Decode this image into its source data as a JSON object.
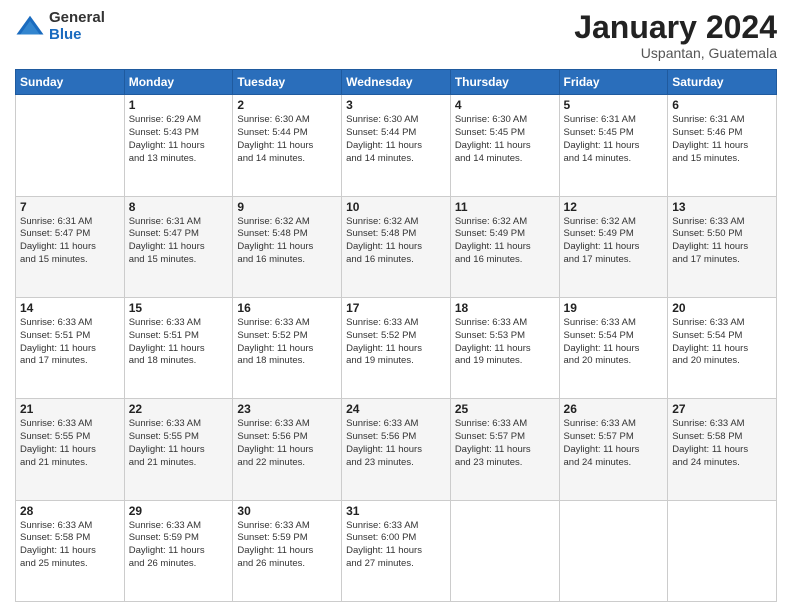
{
  "header": {
    "logo_general": "General",
    "logo_blue": "Blue",
    "month_title": "January 2024",
    "location": "Uspantan, Guatemala"
  },
  "days_of_week": [
    "Sunday",
    "Monday",
    "Tuesday",
    "Wednesday",
    "Thursday",
    "Friday",
    "Saturday"
  ],
  "weeks": [
    [
      {
        "day": "",
        "info": ""
      },
      {
        "day": "1",
        "info": "Sunrise: 6:29 AM\nSunset: 5:43 PM\nDaylight: 11 hours\nand 13 minutes."
      },
      {
        "day": "2",
        "info": "Sunrise: 6:30 AM\nSunset: 5:44 PM\nDaylight: 11 hours\nand 14 minutes."
      },
      {
        "day": "3",
        "info": "Sunrise: 6:30 AM\nSunset: 5:44 PM\nDaylight: 11 hours\nand 14 minutes."
      },
      {
        "day": "4",
        "info": "Sunrise: 6:30 AM\nSunset: 5:45 PM\nDaylight: 11 hours\nand 14 minutes."
      },
      {
        "day": "5",
        "info": "Sunrise: 6:31 AM\nSunset: 5:45 PM\nDaylight: 11 hours\nand 14 minutes."
      },
      {
        "day": "6",
        "info": "Sunrise: 6:31 AM\nSunset: 5:46 PM\nDaylight: 11 hours\nand 15 minutes."
      }
    ],
    [
      {
        "day": "7",
        "info": "Sunrise: 6:31 AM\nSunset: 5:47 PM\nDaylight: 11 hours\nand 15 minutes."
      },
      {
        "day": "8",
        "info": "Sunrise: 6:31 AM\nSunset: 5:47 PM\nDaylight: 11 hours\nand 15 minutes."
      },
      {
        "day": "9",
        "info": "Sunrise: 6:32 AM\nSunset: 5:48 PM\nDaylight: 11 hours\nand 16 minutes."
      },
      {
        "day": "10",
        "info": "Sunrise: 6:32 AM\nSunset: 5:48 PM\nDaylight: 11 hours\nand 16 minutes."
      },
      {
        "day": "11",
        "info": "Sunrise: 6:32 AM\nSunset: 5:49 PM\nDaylight: 11 hours\nand 16 minutes."
      },
      {
        "day": "12",
        "info": "Sunrise: 6:32 AM\nSunset: 5:49 PM\nDaylight: 11 hours\nand 17 minutes."
      },
      {
        "day": "13",
        "info": "Sunrise: 6:33 AM\nSunset: 5:50 PM\nDaylight: 11 hours\nand 17 minutes."
      }
    ],
    [
      {
        "day": "14",
        "info": "Sunrise: 6:33 AM\nSunset: 5:51 PM\nDaylight: 11 hours\nand 17 minutes."
      },
      {
        "day": "15",
        "info": "Sunrise: 6:33 AM\nSunset: 5:51 PM\nDaylight: 11 hours\nand 18 minutes."
      },
      {
        "day": "16",
        "info": "Sunrise: 6:33 AM\nSunset: 5:52 PM\nDaylight: 11 hours\nand 18 minutes."
      },
      {
        "day": "17",
        "info": "Sunrise: 6:33 AM\nSunset: 5:52 PM\nDaylight: 11 hours\nand 19 minutes."
      },
      {
        "day": "18",
        "info": "Sunrise: 6:33 AM\nSunset: 5:53 PM\nDaylight: 11 hours\nand 19 minutes."
      },
      {
        "day": "19",
        "info": "Sunrise: 6:33 AM\nSunset: 5:54 PM\nDaylight: 11 hours\nand 20 minutes."
      },
      {
        "day": "20",
        "info": "Sunrise: 6:33 AM\nSunset: 5:54 PM\nDaylight: 11 hours\nand 20 minutes."
      }
    ],
    [
      {
        "day": "21",
        "info": "Sunrise: 6:33 AM\nSunset: 5:55 PM\nDaylight: 11 hours\nand 21 minutes."
      },
      {
        "day": "22",
        "info": "Sunrise: 6:33 AM\nSunset: 5:55 PM\nDaylight: 11 hours\nand 21 minutes."
      },
      {
        "day": "23",
        "info": "Sunrise: 6:33 AM\nSunset: 5:56 PM\nDaylight: 11 hours\nand 22 minutes."
      },
      {
        "day": "24",
        "info": "Sunrise: 6:33 AM\nSunset: 5:56 PM\nDaylight: 11 hours\nand 23 minutes."
      },
      {
        "day": "25",
        "info": "Sunrise: 6:33 AM\nSunset: 5:57 PM\nDaylight: 11 hours\nand 23 minutes."
      },
      {
        "day": "26",
        "info": "Sunrise: 6:33 AM\nSunset: 5:57 PM\nDaylight: 11 hours\nand 24 minutes."
      },
      {
        "day": "27",
        "info": "Sunrise: 6:33 AM\nSunset: 5:58 PM\nDaylight: 11 hours\nand 24 minutes."
      }
    ],
    [
      {
        "day": "28",
        "info": "Sunrise: 6:33 AM\nSunset: 5:58 PM\nDaylight: 11 hours\nand 25 minutes."
      },
      {
        "day": "29",
        "info": "Sunrise: 6:33 AM\nSunset: 5:59 PM\nDaylight: 11 hours\nand 26 minutes."
      },
      {
        "day": "30",
        "info": "Sunrise: 6:33 AM\nSunset: 5:59 PM\nDaylight: 11 hours\nand 26 minutes."
      },
      {
        "day": "31",
        "info": "Sunrise: 6:33 AM\nSunset: 6:00 PM\nDaylight: 11 hours\nand 27 minutes."
      },
      {
        "day": "",
        "info": ""
      },
      {
        "day": "",
        "info": ""
      },
      {
        "day": "",
        "info": ""
      }
    ]
  ]
}
